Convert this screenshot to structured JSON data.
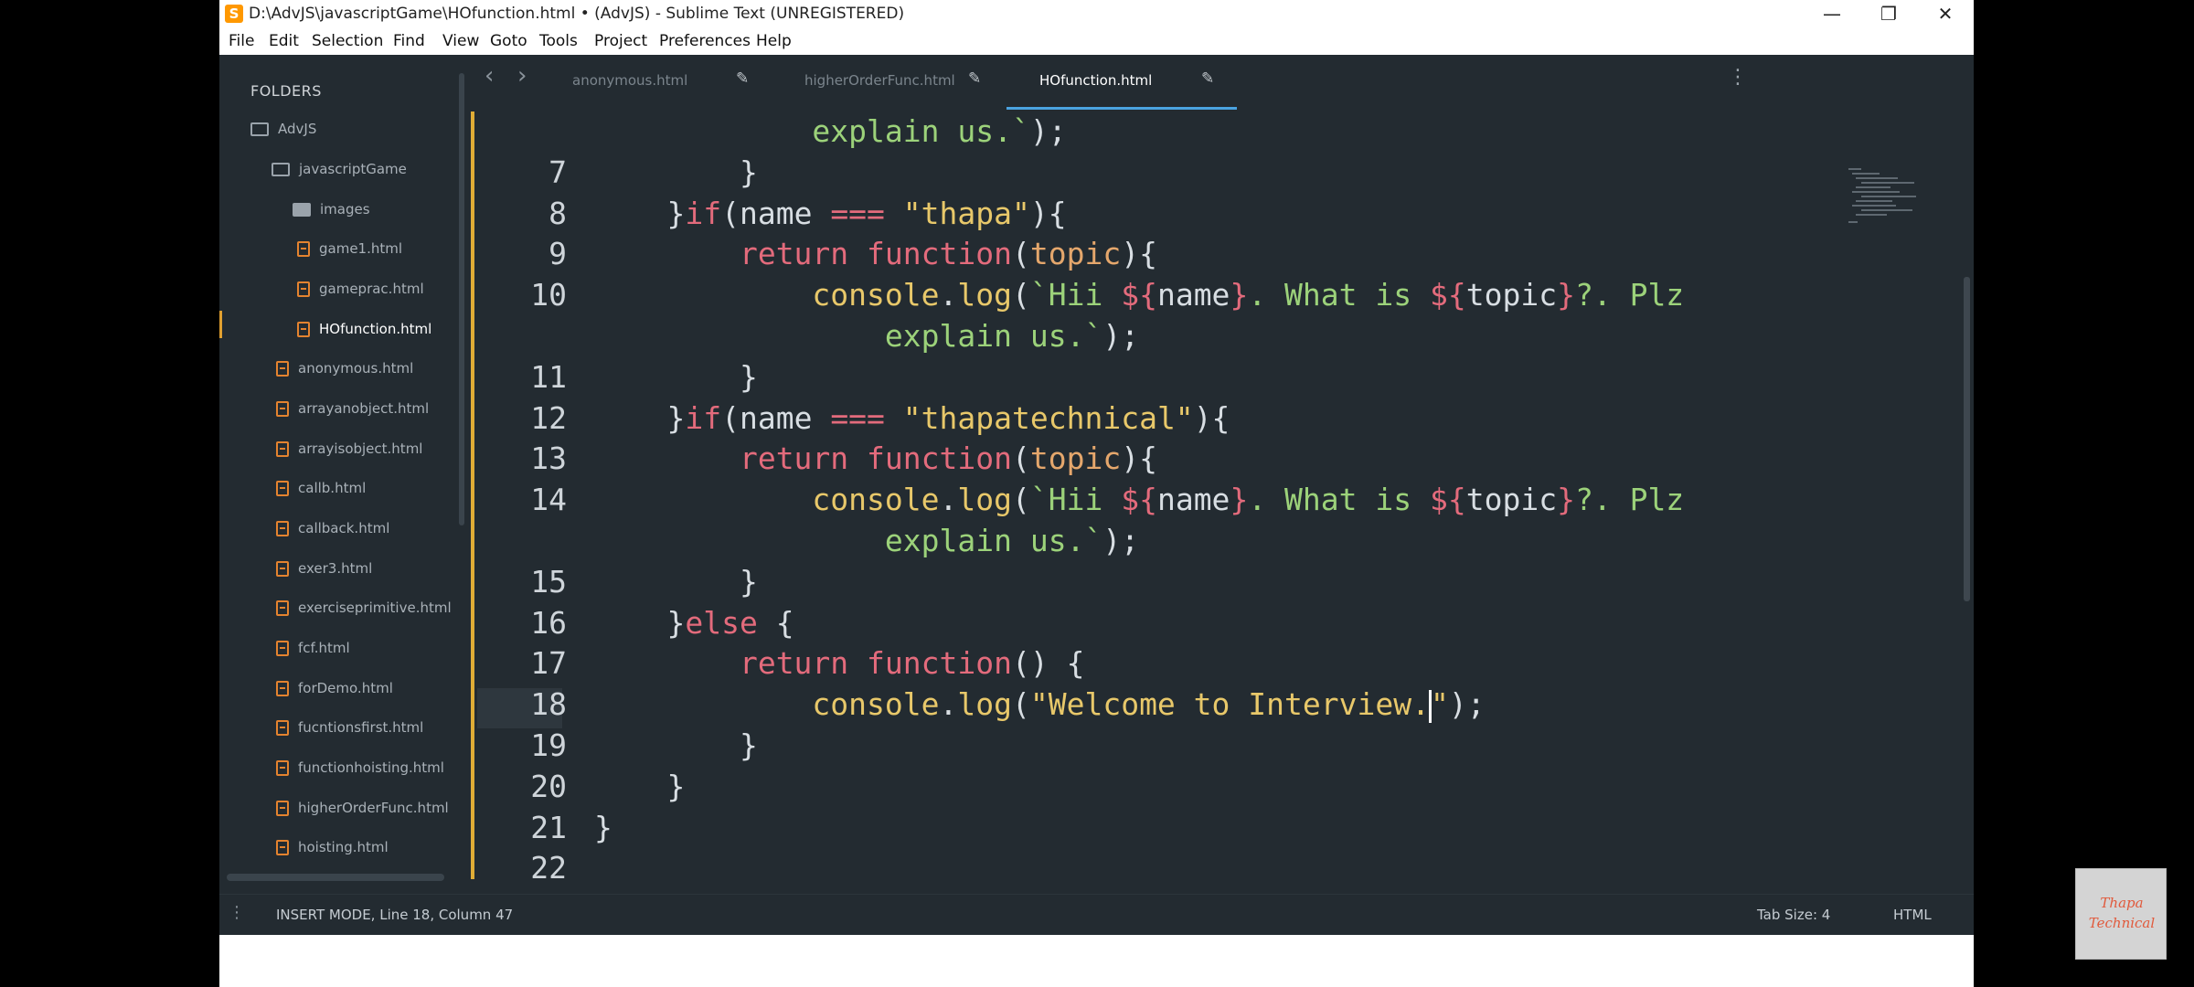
{
  "window": {
    "title": "D:\\AdvJS\\javascriptGame\\HOfunction.html • (AdvJS) - Sublime Text (UNREGISTERED)",
    "app_icon_glyph": "S",
    "minimize_glyph": "—",
    "maximize_glyph": "❐",
    "close_glyph": "✕"
  },
  "menu": [
    "File",
    "Edit",
    "Selection",
    "Find",
    "View",
    "Goto",
    "Tools",
    "Project",
    "Preferences",
    "Help"
  ],
  "sidebar": {
    "header": "FOLDERS",
    "items": [
      {
        "label": "AdvJS",
        "icon": "folder-icon"
      },
      {
        "label": "javascriptGame",
        "icon": "folder-icon"
      },
      {
        "label": "images",
        "icon": "folder-filled-icon"
      },
      {
        "label": "game1.html",
        "icon": "html-file-icon"
      },
      {
        "label": "gameprac.html",
        "icon": "html-file-icon"
      },
      {
        "label": "HOfunction.html",
        "icon": "html-file-icon"
      },
      {
        "label": "anonymous.html",
        "icon": "html-file-icon"
      },
      {
        "label": "arrayanobject.html",
        "icon": "html-file-icon"
      },
      {
        "label": "arrayisobject.html",
        "icon": "html-file-icon"
      },
      {
        "label": "callb.html",
        "icon": "html-file-icon"
      },
      {
        "label": "callback.html",
        "icon": "html-file-icon"
      },
      {
        "label": "exer3.html",
        "icon": "html-file-icon"
      },
      {
        "label": "exerciseprimitive.html",
        "icon": "html-file-icon"
      },
      {
        "label": "fcf.html",
        "icon": "html-file-icon"
      },
      {
        "label": "forDemo.html",
        "icon": "html-file-icon"
      },
      {
        "label": "fucntionsfirst.html",
        "icon": "html-file-icon"
      },
      {
        "label": "functionhoisting.html",
        "icon": "html-file-icon"
      },
      {
        "label": "higherOrderFunc.html",
        "icon": "html-file-icon"
      },
      {
        "label": "hoisting.html",
        "icon": "html-file-icon"
      }
    ]
  },
  "tabs": {
    "back_glyph": "‹",
    "forward_glyph": "›",
    "edit_glyph": "✎",
    "more_glyph": "⋮",
    "items": [
      {
        "label": "anonymous.html"
      },
      {
        "label": "higherOrderFunc.html"
      },
      {
        "label": "HOfunction.html",
        "active": true
      }
    ]
  },
  "editor": {
    "lines": [
      {
        "n": "",
        "tokens": [
          [
            "            ",
            "v"
          ],
          [
            "explain us.`",
            "t"
          ],
          [
            ");",
            "v"
          ]
        ]
      },
      {
        "n": "7",
        "tokens": [
          [
            "        }",
            "v"
          ]
        ]
      },
      {
        "n": "8",
        "tokens": [
          [
            "    }",
            "v"
          ],
          [
            "if",
            "k"
          ],
          [
            "(name ",
            "v"
          ],
          [
            "===",
            "op"
          ],
          [
            " ",
            "v"
          ],
          [
            "\"thapa\"",
            "s"
          ],
          [
            "){",
            "v"
          ]
        ]
      },
      {
        "n": "9",
        "tokens": [
          [
            "        ",
            "v"
          ],
          [
            "return",
            "k"
          ],
          [
            " ",
            "v"
          ],
          [
            "function",
            "k"
          ],
          [
            "(",
            "v"
          ],
          [
            "topic",
            "p"
          ],
          [
            "){",
            "v"
          ]
        ]
      },
      {
        "n": "10",
        "tokens": [
          [
            "            ",
            "v"
          ],
          [
            "console",
            "f"
          ],
          [
            ".",
            "v"
          ],
          [
            "log",
            "f"
          ],
          [
            "(",
            "v"
          ],
          [
            "`Hii ",
            "t"
          ],
          [
            "${",
            "k"
          ],
          [
            "name",
            "v"
          ],
          [
            "}",
            "k"
          ],
          [
            ". What is ",
            "t"
          ],
          [
            "${",
            "k"
          ],
          [
            "topic",
            "v"
          ],
          [
            "}",
            "k"
          ],
          [
            "?. Plz",
            "t"
          ]
        ]
      },
      {
        "n": "",
        "tokens": [
          [
            "                ",
            "v"
          ],
          [
            "explain us.`",
            "t"
          ],
          [
            ");",
            "v"
          ]
        ]
      },
      {
        "n": "11",
        "tokens": [
          [
            "        }",
            "v"
          ]
        ]
      },
      {
        "n": "12",
        "tokens": [
          [
            "    }",
            "v"
          ],
          [
            "if",
            "k"
          ],
          [
            "(name ",
            "v"
          ],
          [
            "===",
            "op"
          ],
          [
            " ",
            "v"
          ],
          [
            "\"thapatechnical\"",
            "s"
          ],
          [
            "){",
            "v"
          ]
        ]
      },
      {
        "n": "13",
        "tokens": [
          [
            "        ",
            "v"
          ],
          [
            "return",
            "k"
          ],
          [
            " ",
            "v"
          ],
          [
            "function",
            "k"
          ],
          [
            "(",
            "v"
          ],
          [
            "topic",
            "p"
          ],
          [
            "){",
            "v"
          ]
        ]
      },
      {
        "n": "14",
        "tokens": [
          [
            "            ",
            "v"
          ],
          [
            "console",
            "f"
          ],
          [
            ".",
            "v"
          ],
          [
            "log",
            "f"
          ],
          [
            "(",
            "v"
          ],
          [
            "`Hii ",
            "t"
          ],
          [
            "${",
            "k"
          ],
          [
            "name",
            "v"
          ],
          [
            "}",
            "k"
          ],
          [
            ". What is ",
            "t"
          ],
          [
            "${",
            "k"
          ],
          [
            "topic",
            "v"
          ],
          [
            "}",
            "k"
          ],
          [
            "?. Plz",
            "t"
          ]
        ]
      },
      {
        "n": "",
        "tokens": [
          [
            "                ",
            "v"
          ],
          [
            "explain us.`",
            "t"
          ],
          [
            ");",
            "v"
          ]
        ]
      },
      {
        "n": "15",
        "tokens": [
          [
            "        }",
            "v"
          ]
        ]
      },
      {
        "n": "16",
        "tokens": [
          [
            "    }",
            "v"
          ],
          [
            "else",
            "k"
          ],
          [
            " {",
            "v"
          ]
        ]
      },
      {
        "n": "17",
        "tokens": [
          [
            "        ",
            "v"
          ],
          [
            "return",
            "k"
          ],
          [
            " ",
            "v"
          ],
          [
            "function",
            "k"
          ],
          [
            "() {",
            "v"
          ]
        ]
      },
      {
        "n": "18",
        "tokens": [
          [
            "            ",
            "v"
          ],
          [
            "console",
            "f"
          ],
          [
            ".",
            "v"
          ],
          [
            "log",
            "f"
          ],
          [
            "(",
            "v"
          ],
          [
            "\"Welcome to Interview.",
            "s"
          ],
          [
            "|",
            "cursor"
          ],
          [
            "\"",
            "s"
          ],
          [
            ");",
            "v"
          ]
        ]
      },
      {
        "n": "19",
        "tokens": [
          [
            "        }",
            "v"
          ]
        ]
      },
      {
        "n": "20",
        "tokens": [
          [
            "    }",
            "v"
          ]
        ]
      },
      {
        "n": "21",
        "tokens": [
          [
            "}",
            "v"
          ]
        ]
      },
      {
        "n": "22",
        "tokens": []
      }
    ]
  },
  "status": {
    "grip_glyph": "⋮",
    "mode": "INSERT MODE, Line 18, Column 47",
    "tab_size": "Tab Size: 4",
    "syntax": "HTML"
  },
  "logo": {
    "line1": "Thapa",
    "line2": "Technical"
  },
  "colors": {
    "editor_bg": "#232b31",
    "accent_tab": "#4aa3e0",
    "keyword": "#e36b7c",
    "string": "#e8c86a",
    "template": "#9cd27a",
    "param": "#e5a76c"
  }
}
